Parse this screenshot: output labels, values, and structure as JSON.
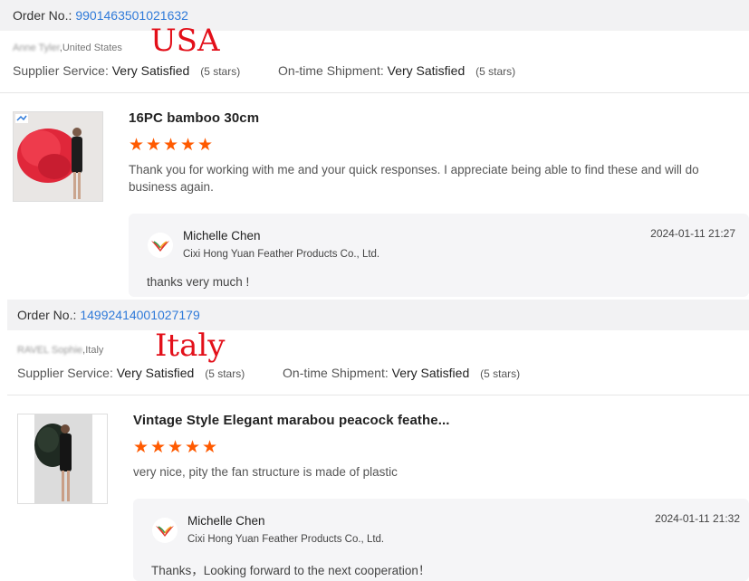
{
  "orders": [
    {
      "order_label": "Order No.:",
      "order_number": "9901463501021632",
      "country_note": "USA",
      "buyer_name": "Anne Tyler",
      "buyer_country": ",United States",
      "supplier_service_label": "Supplier Service:",
      "supplier_service_value": "Very Satisfied",
      "supplier_service_stars": "(5 stars)",
      "shipment_label": "On-time Shipment:",
      "shipment_value": "Very Satisfied",
      "shipment_stars": "(5 stars)",
      "product_title": "16PC bamboo 30cm",
      "rating": 5,
      "comment": "Thank you for working with me and your quick responses.  I appreciate being able to find these and will do business again.",
      "reply": {
        "name": "Michelle Chen",
        "company": "Cixi Hong Yuan Feather Products Co., Ltd.",
        "date": "2024-01-11 21:27",
        "text": "thanks very much !"
      }
    },
    {
      "order_label": "Order No.:",
      "order_number": "14992414001027179",
      "country_note": "Italy",
      "buyer_name": "RAVEL Sophie",
      "buyer_country": ",Italy",
      "supplier_service_label": "Supplier Service:",
      "supplier_service_value": "Very Satisfied",
      "supplier_service_stars": "(5 stars)",
      "shipment_label": "On-time Shipment:",
      "shipment_value": "Very Satisfied",
      "shipment_stars": "(5 stars)",
      "product_title": "Vintage Style Elegant marabou peacock feathe...",
      "rating": 5,
      "comment": "very nice, pity the fan structure is made of plastic",
      "reply": {
        "name": "Michelle Chen",
        "company": "Cixi Hong Yuan Feather Products Co., Ltd.",
        "date": "2024-01-11 21:32",
        "text": "Thanks，Looking forward to the next cooperation！"
      }
    }
  ],
  "colors": {
    "order_link": "#2f7ad9",
    "country_note": "#e3101a",
    "star": "#ff5a00",
    "product1_fan": "#e0273a",
    "product2_fan": "#1f2a22"
  },
  "icons": {
    "star": "star-icon",
    "logo": "feather-company-logo",
    "thumb_badge": "image-badge-icon"
  }
}
